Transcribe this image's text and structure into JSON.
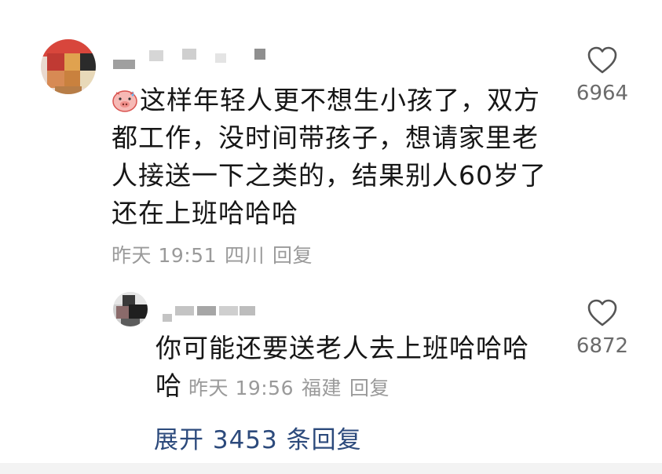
{
  "comment": {
    "text": "这样年轻人更不想生小孩了，双方都工作，没时间带孩子，想请家里老人接送一下之类的，结果别人60岁了还在上班哈哈哈",
    "time": "昨天 19:51",
    "location": "四川",
    "reply_label": "回复",
    "likes": "6964",
    "emoji_icon": "pig-sweat-emoji"
  },
  "reply": {
    "text": "你可能还要送老人去上班哈哈哈哈",
    "time": "昨天 19:56",
    "location": "福建",
    "reply_label": "回复",
    "likes": "6872"
  },
  "expand": {
    "label": "展开 3453 条回复"
  },
  "colors": {
    "link": "#2c4a7c",
    "meta": "#9a9a9a",
    "text": "#161616"
  }
}
